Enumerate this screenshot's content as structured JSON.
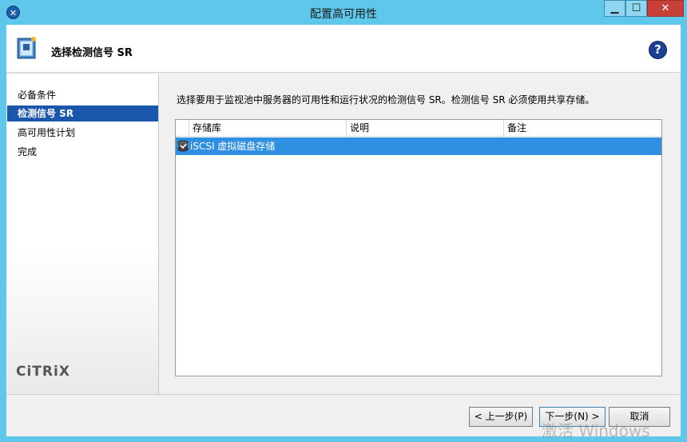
{
  "window": {
    "title": "配置高可用性",
    "app_icon_glyph": "✕",
    "min_glyph": "▁",
    "max_glyph": "☐",
    "close_glyph": "✕"
  },
  "header": {
    "title": "选择检测信号 SR",
    "help_glyph": "?"
  },
  "sidebar": {
    "steps": [
      {
        "label": "必备条件",
        "active": false
      },
      {
        "label": "检测信号 SR",
        "active": true
      },
      {
        "label": "高可用性计划",
        "active": false
      },
      {
        "label": "完成",
        "active": false
      }
    ],
    "logo_text": "CiTRiX"
  },
  "main": {
    "instruction": "选择要用于监视池中服务器的可用性和运行状况的检测信号 SR。检测信号 SR 必须使用共享存储。",
    "columns": [
      "存储库",
      "说明",
      "备注"
    ],
    "rows": [
      {
        "name": "iSCSI 虚拟磁盘存储",
        "description": "",
        "note": "",
        "selected": true,
        "icon": "storage-disk-icon"
      }
    ]
  },
  "footer": {
    "back_label": "< 上一步(P)",
    "next_label": "下一步(N) >",
    "cancel_label": "取消"
  },
  "watermark": "激活 Windows",
  "colors": {
    "titlebar": "#5fc8ea",
    "selection": "#2f8fe0",
    "active_step": "#1a56ac",
    "close_button": "#c7413a"
  }
}
